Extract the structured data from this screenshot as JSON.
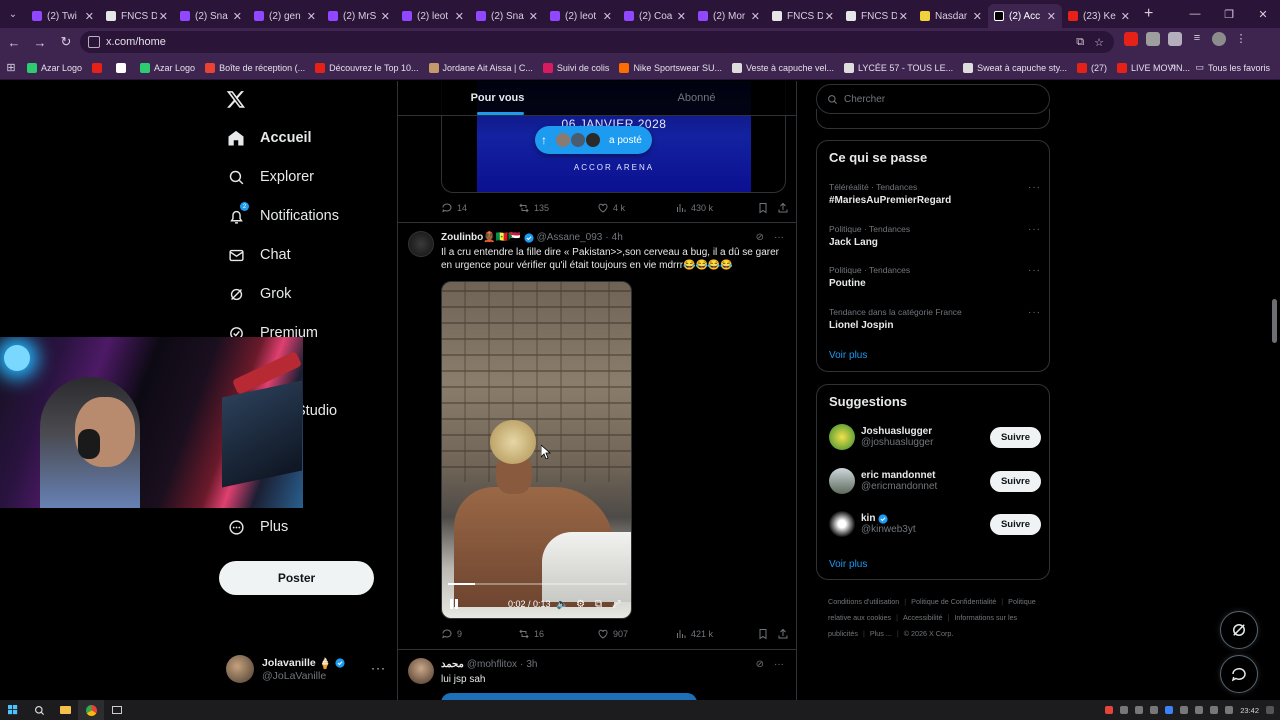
{
  "browser": {
    "tabs": [
      {
        "label": "(2) Twi",
        "color": "#9146ff"
      },
      {
        "label": "FNCS D",
        "color": "#e6e6e6"
      },
      {
        "label": "(2) Sna",
        "color": "#9146ff"
      },
      {
        "label": "(2) gen",
        "color": "#9146ff"
      },
      {
        "label": "(2) MrS",
        "color": "#9146ff"
      },
      {
        "label": "(2) leot",
        "color": "#9146ff"
      },
      {
        "label": "(2) Sna",
        "color": "#9146ff"
      },
      {
        "label": "(2) leot",
        "color": "#9146ff"
      },
      {
        "label": "(2) Coa",
        "color": "#9146ff"
      },
      {
        "label": "(2) Mor",
        "color": "#9146ff"
      },
      {
        "label": "FNCS D",
        "color": "#e6e6e6"
      },
      {
        "label": "FNCS D",
        "color": "#e6e6e6"
      },
      {
        "label": "Nasdar",
        "color": "#f2d23a"
      },
      {
        "label": "(2) Acc",
        "color": "#000000"
      },
      {
        "label": "(23) Ke",
        "color": "#e62117"
      }
    ],
    "url": "x.com/home",
    "bookmarks": [
      {
        "label": "Azar Logo",
        "color": "#2ecc71"
      },
      {
        "label": "",
        "color": "#e62117"
      },
      {
        "label": "",
        "color": "#ffffff"
      },
      {
        "label": "Azar Logo",
        "color": "#2ecc71"
      },
      {
        "label": "Boîte de réception (...",
        "color": "#ea4335"
      },
      {
        "label": "Découvrez le Top 10...",
        "color": "#e62117"
      },
      {
        "label": "Jordane Ait Aissa | C...",
        "color": "#c49a6c"
      },
      {
        "label": "Suivi de colis",
        "color": "#d81b60"
      },
      {
        "label": "Nike Sportswear SU...",
        "color": "#ff6d00"
      },
      {
        "label": "Veste à capuche vel...",
        "color": "#dddddd"
      },
      {
        "label": "LYCÉE 57 - TOUS LE...",
        "color": "#dddddd"
      },
      {
        "label": "Sweat à capuche sty...",
        "color": "#dddddd"
      },
      {
        "label": "(27)",
        "color": "#e62117"
      },
      {
        "label": "LIVE MOVIN...",
        "color": "#e62117"
      }
    ],
    "all_bookmarks": "Tous les favoris"
  },
  "nav": {
    "home": "Accueil",
    "explore": "Explorer",
    "notifications": "Notifications",
    "notifications_badge": "2",
    "chat": "Chat",
    "grok": "Grok",
    "premium": "Premium",
    "creator_studio": "Studio",
    "more": "Plus",
    "post_button": "Poster"
  },
  "account": {
    "name": "Jolavanille",
    "handle": "@JoLaVanille"
  },
  "timeline": {
    "tab_for_you": "Pour vous",
    "tab_following": "Abonné",
    "prev_media": {
      "date": "06 JANVIER 2028",
      "venue": "ACCOR ARENA"
    },
    "posted_pill": "a posté",
    "prev_actions": {
      "replies": "14",
      "reposts": "135",
      "likes": "4 k",
      "views": "430 k"
    },
    "tweet": {
      "name": "Zoulinbo👲🏾🇸🇳🇸🇩",
      "handle": "@Assane_093",
      "time": "4h",
      "text": "Il a cru entendre la fille dire « Pakistan>>,son cerveau a bug, il a dû se garer en urgence pour vérifier qu'il était toujours en vie mdrrr😂😂😂😂",
      "video_time": "0:02 / 0:13",
      "video_progress": 0.15,
      "replies": "9",
      "reposts": "16",
      "likes": "907",
      "views": "421 k"
    },
    "next_tweet": {
      "name": "محمد",
      "handle": "@mohflitox",
      "time": "3h",
      "text": "lui jsp sah"
    }
  },
  "right": {
    "search_placeholder": "Chercher",
    "trends_title": "Ce qui se passe",
    "trends": [
      {
        "context": "Téléréalité · Tendances",
        "name": "#MariesAuPremierRegard"
      },
      {
        "context": "Politique · Tendances",
        "name": "Jack Lang"
      },
      {
        "context": "Politique · Tendances",
        "name": "Poutine"
      },
      {
        "context": "Tendance dans la catégorie France",
        "name": "Lionel Jospin"
      }
    ],
    "trends_more": "Voir plus",
    "suggestions_title": "Suggestions",
    "suggestions": [
      {
        "name": "Joshuaslugger",
        "handle": "@joshuaslugger",
        "verified": false,
        "button": "Suivre"
      },
      {
        "name": "eric mandonnet",
        "handle": "@ericmandonnet",
        "verified": false,
        "button": "Suivre"
      },
      {
        "name": "kin",
        "handle": "@kinweb3yt",
        "verified": true,
        "button": "Suivre"
      }
    ],
    "suggestions_more": "Voir plus",
    "footer": [
      "Conditions d'utilisation",
      "Politique de Confidentialité",
      "Politique relative aux cookies",
      "Accessibilité",
      "Informations sur les publicités",
      "Plus ...",
      "© 2026 X Corp."
    ]
  },
  "taskbar": {
    "clock": "23:42"
  },
  "colors": {
    "accent": "#1d9bf0",
    "chrome": "#3d2550"
  }
}
